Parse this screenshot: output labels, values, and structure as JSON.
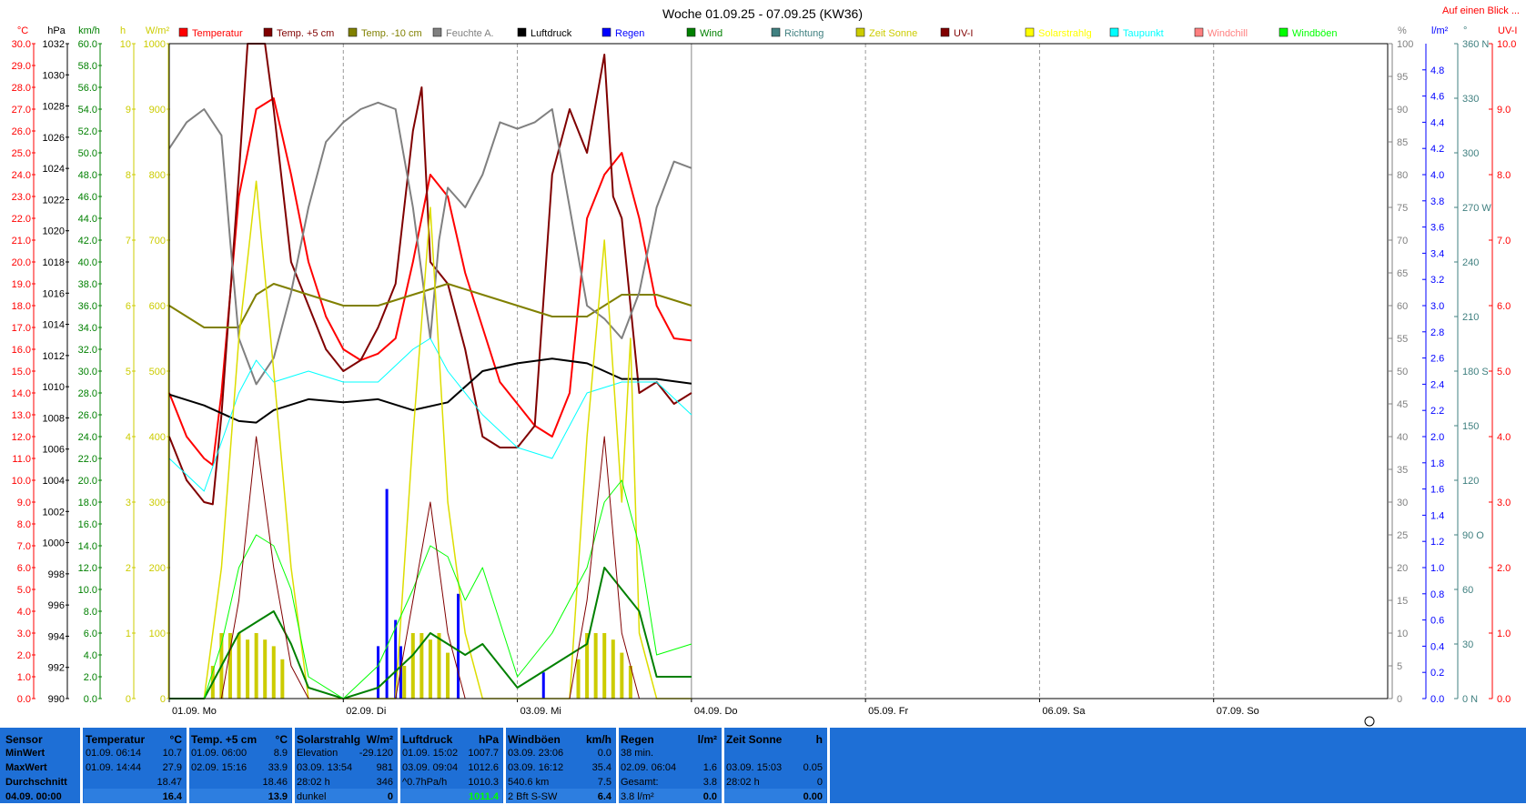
{
  "chart_data": {
    "type": "line",
    "title": "Woche 01.09.25 - 07.09.25 (KW36)",
    "top_link": "Auf einen Blick ...",
    "x_labels": [
      "01.09.  Mo",
      "02.09.  Di",
      "03.09.  Mi",
      "04.09.  Do",
      "05.09.  Fr",
      "06.09.  Sa",
      "07.09.  So"
    ],
    "xlim": [
      0,
      7
    ],
    "left_axes": [
      {
        "unit": "°C",
        "color": "#ff0000",
        "min": 0,
        "max": 30,
        "ticks": [
          "30.0",
          "29.0",
          "28.0",
          "27.0",
          "26.0",
          "25.0",
          "24.0",
          "23.0",
          "22.0",
          "21.0",
          "20.0",
          "19.0",
          "18.0",
          "17.0",
          "16.0",
          "15.0",
          "14.0",
          "13.0",
          "12.0",
          "11.0",
          "10.0",
          "9.0",
          "8.0",
          "7.0",
          "6.0",
          "5.0",
          "4.0",
          "3.0",
          "2.0",
          "1.0",
          "0.0"
        ]
      },
      {
        "unit": "hPa",
        "color": "#000000",
        "min": 990,
        "max": 1032,
        "ticks": [
          "1032",
          "1030",
          "1028",
          "1026",
          "1024",
          "1022",
          "1020",
          "1018",
          "1016",
          "1014",
          "1012",
          "1010",
          "1008",
          "1006",
          "1004",
          "1002",
          "1000",
          "998",
          "996",
          "994",
          "992",
          "990"
        ]
      },
      {
        "unit": "km/h",
        "color": "#008000",
        "min": 0,
        "max": 60,
        "ticks": [
          "60.0",
          "58.0",
          "56.0",
          "54.0",
          "52.0",
          "50.0",
          "48.0",
          "46.0",
          "44.0",
          "42.0",
          "40.0",
          "38.0",
          "36.0",
          "34.0",
          "32.0",
          "30.0",
          "28.0",
          "26.0",
          "24.0",
          "22.0",
          "20.0",
          "18.0",
          "16.0",
          "14.0",
          "12.0",
          "10.0",
          "8.0",
          "6.0",
          "4.0",
          "2.0",
          "0.0"
        ]
      },
      {
        "unit": "h",
        "color": "#cccc00",
        "min": 0,
        "max": 10,
        "ticks": [
          "10",
          "9",
          "8",
          "7",
          "6",
          "5",
          "4",
          "3",
          "2",
          "1",
          "0"
        ]
      },
      {
        "unit": "W/m²",
        "color": "#cccc00",
        "min": 0,
        "max": 1000,
        "ticks": [
          "1000",
          "900",
          "800",
          "700",
          "600",
          "500",
          "400",
          "300",
          "200",
          "100",
          "0"
        ]
      }
    ],
    "right_axes": [
      {
        "unit": "%",
        "color": "#808080",
        "min": 0,
        "max": 100,
        "ticks": [
          "100",
          "95",
          "90",
          "85",
          "80",
          "75",
          "70",
          "65",
          "60",
          "55",
          "50",
          "45",
          "40",
          "35",
          "30",
          "25",
          "20",
          "15",
          "10",
          "5",
          "0"
        ]
      },
      {
        "unit": "l/m²",
        "color": "#0000ff",
        "min": 0,
        "max": 5,
        "ticks": [
          "4.8",
          "4.6",
          "4.4",
          "4.2",
          "4.0",
          "3.8",
          "3.6",
          "3.4",
          "3.2",
          "3.0",
          "2.8",
          "2.6",
          "2.4",
          "2.2",
          "2.0",
          "1.8",
          "1.6",
          "1.4",
          "1.2",
          "1.0",
          "0.8",
          "0.6",
          "0.4",
          "0.2",
          "0.0"
        ]
      },
      {
        "unit": "°",
        "color": "#408080",
        "min": 0,
        "max": 360,
        "ticks": [
          "360 N",
          "330",
          "300",
          "270 W",
          "240",
          "210",
          "180 S",
          "150",
          "120",
          "90  O",
          "60",
          "30",
          "0    N"
        ]
      },
      {
        "unit": "UV-I",
        "color": "#ff0000",
        "min": 0,
        "max": 10,
        "ticks": [
          "10.0",
          "9.0",
          "8.0",
          "7.0",
          "6.0",
          "5.0",
          "4.0",
          "3.0",
          "2.0",
          "1.0",
          "0.0"
        ]
      }
    ],
    "legend": [
      {
        "name": "Temperatur",
        "color": "#ff0000"
      },
      {
        "name": "Temp. +5 cm",
        "color": "#800000"
      },
      {
        "name": "Temp. -10 cm",
        "color": "#808000"
      },
      {
        "name": "Feuchte A.",
        "color": "#808080"
      },
      {
        "name": "Luftdruck",
        "color": "#000000"
      },
      {
        "name": "Regen",
        "color": "#0000ff"
      },
      {
        "name": "Wind",
        "color": "#008000"
      },
      {
        "name": "Richtung",
        "color": "#408080"
      },
      {
        "name": "Zeit Sonne",
        "color": "#cccc00"
      },
      {
        "name": "UV-I",
        "color": "#800000"
      },
      {
        "name": "Solarstrahlg",
        "color": "#ffff00"
      },
      {
        "name": "Taupunkt",
        "color": "#00ffff"
      },
      {
        "name": "Windchill",
        "color": "#ff8080"
      },
      {
        "name": "Windböen",
        "color": "#00ff00"
      }
    ],
    "series": [
      {
        "name": "Temperatur",
        "axis": "°C",
        "color": "#ff0000",
        "width": 2,
        "x": [
          0,
          0.1,
          0.2,
          0.25,
          0.3,
          0.4,
          0.5,
          0.6,
          0.7,
          0.8,
          0.9,
          1.0,
          1.1,
          1.2,
          1.3,
          1.4,
          1.5,
          1.6,
          1.7,
          1.8,
          1.9,
          2.0,
          2.1,
          2.2,
          2.3,
          2.4,
          2.5,
          2.6,
          2.7,
          2.8,
          2.9,
          3.0
        ],
        "y": [
          14.0,
          12.0,
          11.0,
          10.7,
          14.0,
          23.0,
          27.0,
          27.5,
          24.0,
          20.0,
          17.5,
          16.0,
          15.5,
          15.8,
          16.5,
          20.0,
          24.0,
          23.0,
          19.5,
          17.0,
          14.5,
          13.5,
          12.5,
          12.0,
          14.0,
          22.0,
          24.0,
          25.0,
          22.0,
          18.0,
          16.5,
          16.4
        ]
      },
      {
        "name": "Temp. +5 cm",
        "axis": "°C",
        "color": "#800000",
        "width": 2,
        "x": [
          0,
          0.1,
          0.2,
          0.25,
          0.3,
          0.4,
          0.45,
          0.55,
          0.6,
          0.7,
          0.8,
          0.9,
          1.0,
          1.1,
          1.2,
          1.3,
          1.4,
          1.45,
          1.5,
          1.6,
          1.7,
          1.8,
          1.9,
          2.0,
          2.1,
          2.2,
          2.3,
          2.4,
          2.5,
          2.55,
          2.6,
          2.65,
          2.7,
          2.8,
          2.9,
          3.0
        ],
        "y": [
          12.0,
          10.0,
          9.0,
          8.9,
          13.0,
          24.0,
          30.0,
          30.0,
          27.0,
          20.0,
          18.0,
          16.0,
          15.0,
          15.5,
          17.0,
          19.0,
          26.0,
          28.0,
          20.0,
          19.0,
          16.0,
          12.0,
          11.5,
          11.5,
          12.5,
          24.0,
          27.0,
          25.0,
          29.5,
          23.0,
          22.0,
          18.0,
          14.0,
          14.5,
          13.5,
          14.0
        ]
      },
      {
        "name": "Temp. -10 cm",
        "axis": "°C",
        "color": "#808000",
        "width": 2,
        "x": [
          0,
          0.2,
          0.4,
          0.5,
          0.6,
          0.8,
          1.0,
          1.2,
          1.4,
          1.6,
          1.8,
          2.0,
          2.2,
          2.4,
          2.6,
          2.8,
          3.0
        ],
        "y": [
          18.0,
          17.0,
          17.0,
          18.5,
          19.0,
          18.5,
          18.0,
          18.0,
          18.5,
          19.0,
          18.5,
          18.0,
          17.5,
          17.5,
          18.5,
          18.5,
          18.0
        ]
      },
      {
        "name": "Feuchte A.",
        "axis": "%",
        "color": "#808080",
        "width": 2,
        "x": [
          0,
          0.1,
          0.2,
          0.3,
          0.35,
          0.4,
          0.5,
          0.6,
          0.7,
          0.8,
          0.9,
          1.0,
          1.1,
          1.2,
          1.3,
          1.4,
          1.5,
          1.55,
          1.6,
          1.7,
          1.8,
          1.9,
          2.0,
          2.1,
          2.2,
          2.3,
          2.4,
          2.5,
          2.6,
          2.7,
          2.8,
          2.9,
          3.0
        ],
        "y": [
          84.0,
          88.0,
          90.0,
          86.0,
          70.0,
          55.0,
          48.0,
          52.0,
          62.0,
          75.0,
          85.0,
          88.0,
          90.0,
          91.0,
          90.0,
          75.0,
          55.0,
          70.0,
          78.0,
          75.0,
          80.0,
          88.0,
          87.0,
          88.0,
          90.0,
          75.0,
          60.0,
          58.0,
          55.0,
          62.0,
          75.0,
          82.0,
          81.0
        ]
      },
      {
        "name": "Luftdruck",
        "axis": "hPa",
        "color": "#000000",
        "width": 2,
        "x": [
          0,
          0.2,
          0.4,
          0.5,
          0.6,
          0.8,
          1.0,
          1.2,
          1.4,
          1.6,
          1.8,
          2.0,
          2.2,
          2.4,
          2.6,
          2.8,
          3.0
        ],
        "y": [
          1009.5,
          1008.8,
          1007.8,
          1007.7,
          1008.5,
          1009.2,
          1009.0,
          1009.2,
          1008.5,
          1009.0,
          1011.0,
          1011.5,
          1011.8,
          1011.5,
          1010.5,
          1010.5,
          1010.2
        ]
      },
      {
        "name": "Taupunkt",
        "axis": "°C",
        "color": "#00ffff",
        "width": 1,
        "x": [
          0,
          0.2,
          0.4,
          0.5,
          0.6,
          0.8,
          1.0,
          1.2,
          1.4,
          1.5,
          1.6,
          1.8,
          2.0,
          2.2,
          2.4,
          2.6,
          2.8,
          3.0
        ],
        "y": [
          11.0,
          9.5,
          14.0,
          15.5,
          14.5,
          15.0,
          14.5,
          14.5,
          16.0,
          16.5,
          15.0,
          13.0,
          11.5,
          11.0,
          14.0,
          14.5,
          14.5,
          13.0
        ]
      },
      {
        "name": "Solarstrahlg",
        "axis": "W/m²",
        "color": "#dddd00",
        "width": 1.5,
        "x": [
          0,
          0.2,
          0.3,
          0.4,
          0.5,
          0.6,
          0.7,
          0.8,
          1.0,
          1.3,
          1.4,
          1.5,
          1.6,
          1.7,
          1.8,
          2.0,
          2.3,
          2.4,
          2.5,
          2.6,
          2.65,
          2.7,
          2.8,
          3.0
        ],
        "y": [
          0,
          0,
          200,
          550,
          790,
          500,
          200,
          0,
          0,
          0,
          400,
          750,
          300,
          100,
          0,
          0,
          0,
          400,
          700,
          300,
          550,
          100,
          0,
          0
        ]
      },
      {
        "name": "Wind",
        "axis": "km/h",
        "color": "#008000",
        "width": 2,
        "x": [
          0,
          0.2,
          0.3,
          0.4,
          0.5,
          0.6,
          0.7,
          0.8,
          1.0,
          1.2,
          1.4,
          1.5,
          1.6,
          1.7,
          1.8,
          2.0,
          2.2,
          2.4,
          2.5,
          2.6,
          2.7,
          2.8,
          3.0
        ],
        "y": [
          0,
          0,
          3,
          6,
          7,
          8,
          5,
          1,
          0,
          1,
          4,
          6,
          5,
          4,
          5,
          1,
          3,
          5,
          12,
          10,
          8,
          2,
          2
        ]
      },
      {
        "name": "Windböen",
        "axis": "km/h",
        "color": "#00ff00",
        "width": 1,
        "x": [
          0,
          0.2,
          0.3,
          0.4,
          0.5,
          0.6,
          0.7,
          0.8,
          1.0,
          1.2,
          1.4,
          1.5,
          1.6,
          1.7,
          1.8,
          2.0,
          2.2,
          2.4,
          2.5,
          2.6,
          2.7,
          2.8,
          3.0
        ],
        "y": [
          0,
          0,
          5,
          12,
          15,
          14,
          10,
          2,
          0,
          3,
          10,
          14,
          13,
          9,
          12,
          2,
          6,
          12,
          18,
          20,
          14,
          4,
          5
        ]
      },
      {
        "name": "UV-I",
        "axis": "UV-I",
        "color": "#800000",
        "width": 1,
        "x": [
          0,
          0.3,
          0.4,
          0.5,
          0.6,
          0.7,
          0.8,
          1.3,
          1.4,
          1.5,
          1.6,
          1.7,
          2.3,
          2.4,
          2.5,
          2.6,
          2.7
        ],
        "y": [
          0,
          0,
          1.5,
          4.0,
          2.0,
          0.5,
          0,
          0,
          1.5,
          3.0,
          1.0,
          0,
          0,
          1.5,
          4.0,
          1.0,
          0
        ]
      }
    ],
    "rain_bars": {
      "x": [
        1.2,
        1.25,
        1.3,
        1.33,
        1.66,
        2.15
      ],
      "y": [
        0.4,
        1.6,
        0.6,
        0.4,
        0.8,
        0.2
      ]
    },
    "sun_bars_x": [
      0.25,
      0.3,
      0.35,
      0.4,
      0.45,
      0.5,
      0.55,
      0.6,
      0.65,
      1.35,
      1.4,
      1.45,
      1.5,
      1.55,
      1.6,
      2.35,
      2.4,
      2.45,
      2.5,
      2.55,
      2.6,
      2.65
    ],
    "sun_bars_h": [
      0.5,
      1,
      1,
      1,
      0.9,
      1,
      0.9,
      0.8,
      0.6,
      0.5,
      1,
      1,
      0.9,
      1,
      0.7,
      0.6,
      1,
      1,
      1,
      0.9,
      0.7,
      0.5
    ],
    "circle_label": "O"
  },
  "bottom_panel": {
    "sensor": {
      "header": "Sensor",
      "rows": [
        "MinWert",
        "MaxWert",
        "Durchschnitt",
        "04.09.  00:00"
      ]
    },
    "temperatur": {
      "header": "Temperatur",
      "unit": "°C",
      "rows": [
        [
          "01.09.  06:14",
          "10.7"
        ],
        [
          "01.09.  14:44",
          "27.9"
        ],
        [
          "",
          "18.47"
        ],
        [
          "",
          "16.4"
        ]
      ]
    },
    "temp5": {
      "header": "Temp. +5 cm",
      "unit": "°C",
      "rows": [
        [
          "01.09.  06:00",
          "8.9"
        ],
        [
          "02.09.  15:16",
          "33.9"
        ],
        [
          "",
          "18.46"
        ],
        [
          "",
          "13.9"
        ]
      ]
    },
    "solar": {
      "header": "Solarstrahlg",
      "unit": "W/m²",
      "rows": [
        [
          "Elevation",
          "-29.120"
        ],
        [
          "03.09.  13:54",
          "981"
        ],
        [
          "28:02 h",
          "346"
        ],
        [
          "dunkel",
          "0"
        ]
      ]
    },
    "luftdruck": {
      "header": "Luftdruck",
      "unit": "hPa",
      "rows": [
        [
          "01.09.  15:02",
          "1007.7"
        ],
        [
          "03.09.  09:04",
          "1012.6"
        ],
        [
          "^0.7hPa/h",
          "1010.3"
        ],
        [
          "",
          "1011.4"
        ]
      ]
    },
    "windboeen": {
      "header": "Windböen",
      "unit": "km/h",
      "rows": [
        [
          "03.09.  23:06",
          "0.0"
        ],
        [
          "03.09.  16:12",
          "35.4"
        ],
        [
          "540.6 km",
          "7.5"
        ],
        [
          "2 Bft S-SW",
          "6.4"
        ]
      ]
    },
    "regen": {
      "header": "Regen",
      "unit": "l/m²",
      "rows": [
        [
          "38 min.",
          ""
        ],
        [
          "02.09.  06:04",
          "1.6"
        ],
        [
          "Gesamt:",
          "3.8"
        ],
        [
          "3.8 l/m²",
          "0.0"
        ]
      ]
    },
    "sonne": {
      "header": "Zeit Sonne",
      "unit": "h",
      "rows": [
        [
          "",
          ""
        ],
        [
          "03.09.  15:03",
          "0.05"
        ],
        [
          "28:02 h",
          "0"
        ],
        [
          "",
          "0.00"
        ]
      ]
    }
  }
}
